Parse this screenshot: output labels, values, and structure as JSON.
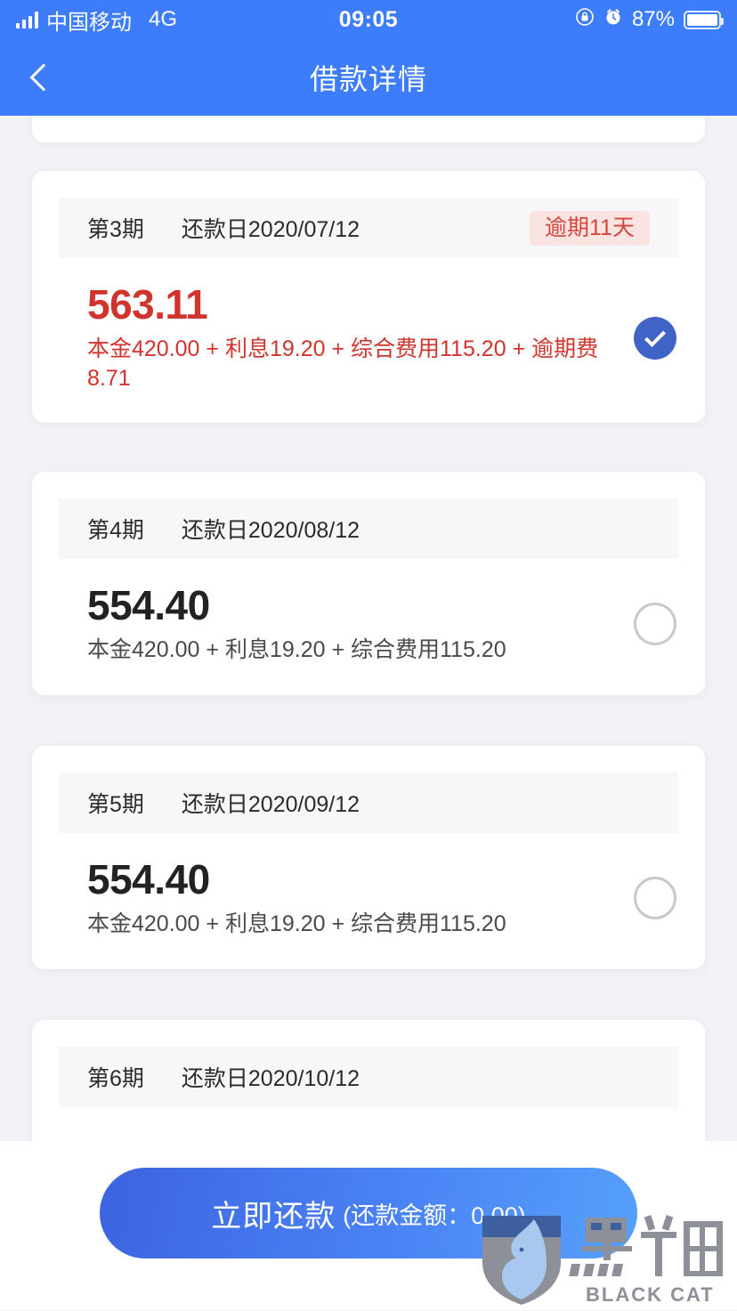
{
  "status_bar": {
    "carrier": "中国移动",
    "network": "4G",
    "time": "09:05",
    "battery_percent": "87%",
    "icons": [
      "signal-bars-icon",
      "rotation-lock-icon",
      "alarm-clock-icon",
      "battery-icon"
    ]
  },
  "nav": {
    "title": "借款详情",
    "back_icon": "chevron-left-icon"
  },
  "installments": [
    {
      "term": "第3期",
      "due_date": "还款日2020/07/12",
      "badge": "逾期11天",
      "amount": "563.11",
      "breakdown": "本金420.00 + 利息19.20 + 综合费用115.20 + 逾期费8.71",
      "overdue": true,
      "selected": true
    },
    {
      "term": "第4期",
      "due_date": "还款日2020/08/12",
      "badge": "",
      "amount": "554.40",
      "breakdown": "本金420.00 + 利息19.20 + 综合费用115.20",
      "overdue": false,
      "selected": false
    },
    {
      "term": "第5期",
      "due_date": "还款日2020/09/12",
      "badge": "",
      "amount": "554.40",
      "breakdown": "本金420.00 + 利息19.20 + 综合费用115.20",
      "overdue": false,
      "selected": false
    },
    {
      "term": "第6期",
      "due_date": "还款日2020/10/12",
      "badge": "",
      "amount": "",
      "breakdown": "",
      "overdue": false,
      "selected": false
    }
  ],
  "footer": {
    "pay_label": "立即还款",
    "pay_amount_label": "(还款金额：0.00)"
  },
  "watermark": {
    "cn": "黑猫",
    "en": "BLACK CAT",
    "icon": "black-cat-shield-icon"
  },
  "colors": {
    "brand_blue": "#3d7cfa",
    "overdue_red": "#d0342c",
    "badge_bg": "#fae4e2",
    "page_bg": "#f2f3f7",
    "checked_blue": "#4063c8"
  }
}
